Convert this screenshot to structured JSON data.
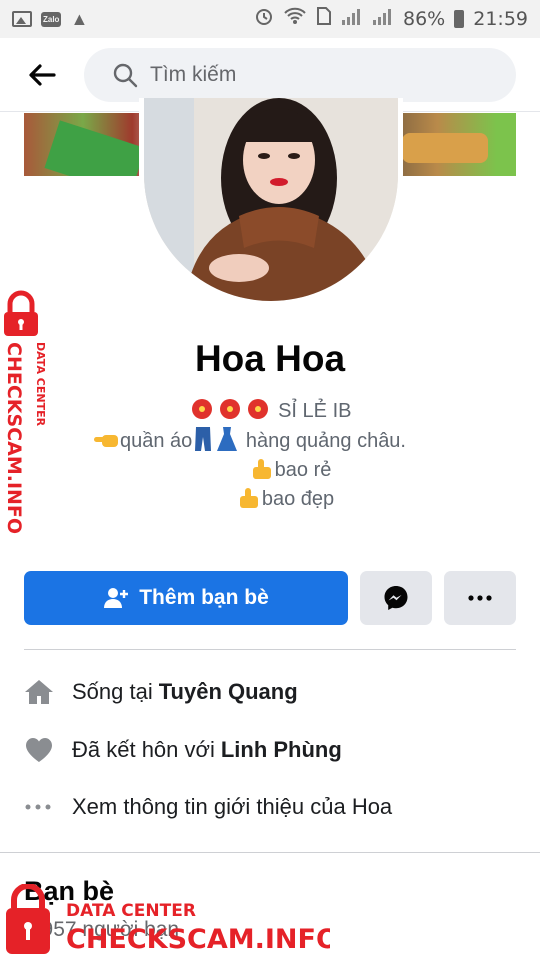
{
  "status_bar": {
    "battery": "86%",
    "time": "21:59"
  },
  "header": {
    "search_placeholder": "Tìm kiếm"
  },
  "profile": {
    "name": "Hoa Hoa",
    "bio": {
      "line1": "SỈ LẺ  IB",
      "line2_a": "quần áo",
      "line2_b": "hàng quảng châu.",
      "line3": "bao rẻ",
      "line4": "bao đẹp"
    }
  },
  "actions": {
    "add_friend_label": "Thêm bạn bè"
  },
  "info": {
    "lives_prefix": "Sống tại",
    "lives_place": "Tuyên Quang",
    "married_prefix": "Đã kết hôn với",
    "married_name": "Linh Phùng",
    "about_label": "Xem thông tin giới thiệu của Hoa"
  },
  "friends": {
    "title": "Bạn bè",
    "count": "4.957 người bạn"
  },
  "watermark": {
    "brand": "CHECKSCAM.INFO",
    "tag": "DATA CENTER",
    "color": "#e52228"
  },
  "colors": {
    "accent": "#1b74e4",
    "button_gray": "#e4e6eb"
  }
}
